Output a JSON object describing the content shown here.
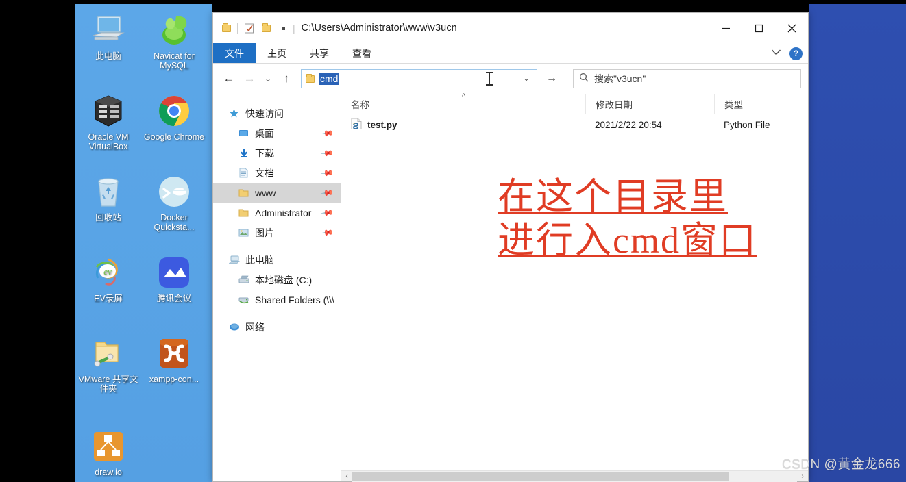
{
  "desktop": {
    "icons": [
      {
        "label": "此电脑",
        "icon": "computer-icon"
      },
      {
        "label": "Navicat for MySQL",
        "icon": "navicat-icon"
      },
      {
        "label": "Oracle VM VirtualBox",
        "icon": "virtualbox-icon"
      },
      {
        "label": "Google Chrome",
        "icon": "chrome-icon"
      },
      {
        "label": "回收站",
        "icon": "recycle-bin-icon"
      },
      {
        "label": "Docker Quicksta...",
        "icon": "docker-icon"
      },
      {
        "label": "EV录屏",
        "icon": "ev-recorder-icon"
      },
      {
        "label": "腾讯会议",
        "icon": "tencent-meeting-icon"
      },
      {
        "label": "VMware 共享文件夹",
        "icon": "vmware-shared-folder-icon"
      },
      {
        "label": "xampp-con...",
        "icon": "xampp-icon"
      },
      {
        "label": "draw.io",
        "icon": "drawio-icon"
      }
    ]
  },
  "window": {
    "title_path": "C:\\Users\\Administrator\\www\\v3ucn",
    "controls": {
      "minimize": "–",
      "maximize": "□",
      "close": "✕"
    },
    "ribbon": {
      "tabs": [
        {
          "label": "文件",
          "active": true
        },
        {
          "label": "主页",
          "active": false
        },
        {
          "label": "共享",
          "active": false
        },
        {
          "label": "查看",
          "active": false
        }
      ],
      "collapse_icon": "chevron-down-icon",
      "help_label": "?"
    },
    "address": {
      "back_icon": "←",
      "forward_icon": "→",
      "recent_icon": "⌄",
      "up_icon": "↑",
      "value": "cmd",
      "dropdown_icon": "⌄",
      "go_icon": "→"
    },
    "search": {
      "icon": "search-icon",
      "placeholder": "搜索\"v3ucn\""
    },
    "nav_pane": {
      "items": [
        {
          "label": "快速访问",
          "icon": "star-icon",
          "indent": false,
          "pinned": false,
          "selected": false
        },
        {
          "label": "桌面",
          "icon": "desktop-icon",
          "indent": true,
          "pinned": true,
          "selected": false
        },
        {
          "label": "下载",
          "icon": "download-icon",
          "indent": true,
          "pinned": true,
          "selected": false
        },
        {
          "label": "文档",
          "icon": "document-icon",
          "indent": true,
          "pinned": true,
          "selected": false
        },
        {
          "label": "www",
          "icon": "folder-icon",
          "indent": true,
          "pinned": true,
          "selected": true
        },
        {
          "label": "Administrator",
          "icon": "folder-icon",
          "indent": true,
          "pinned": true,
          "selected": false
        },
        {
          "label": "图片",
          "icon": "pictures-icon",
          "indent": true,
          "pinned": true,
          "selected": false
        },
        {
          "label": "此电脑",
          "icon": "computer-icon",
          "indent": false,
          "pinned": false,
          "selected": false,
          "gap_before": true
        },
        {
          "label": "本地磁盘 (C:)",
          "icon": "drive-icon",
          "indent": true,
          "pinned": false,
          "selected": false
        },
        {
          "label": "Shared Folders (\\\\\\",
          "icon": "network-drive-icon",
          "indent": true,
          "pinned": false,
          "selected": false
        },
        {
          "label": "网络",
          "icon": "network-icon",
          "indent": false,
          "pinned": false,
          "selected": false,
          "gap_before": true
        }
      ]
    },
    "file_list": {
      "columns": [
        {
          "label": "名称"
        },
        {
          "label": "修改日期"
        },
        {
          "label": "类型"
        }
      ],
      "sort_indicator": "^",
      "rows": [
        {
          "name": "test.py",
          "date": "2021/2/22 20:54",
          "type": "Python File",
          "icon": "python-file-icon"
        }
      ]
    },
    "scrollbar": {
      "left_arrow": "‹",
      "right_arrow": "›"
    }
  },
  "annotation": {
    "line1": "在这个目录里",
    "line2": "进行入cmd窗口",
    "color": "#E03C24"
  },
  "watermark": "CSDN @黄金龙666",
  "colors": {
    "accent_blue": "#1E6FC4",
    "desktop_left": "#5CA7E8",
    "desktop_right": "#2E4FB0",
    "selection": "#2A62B6",
    "annotation_red": "#E03C24"
  }
}
